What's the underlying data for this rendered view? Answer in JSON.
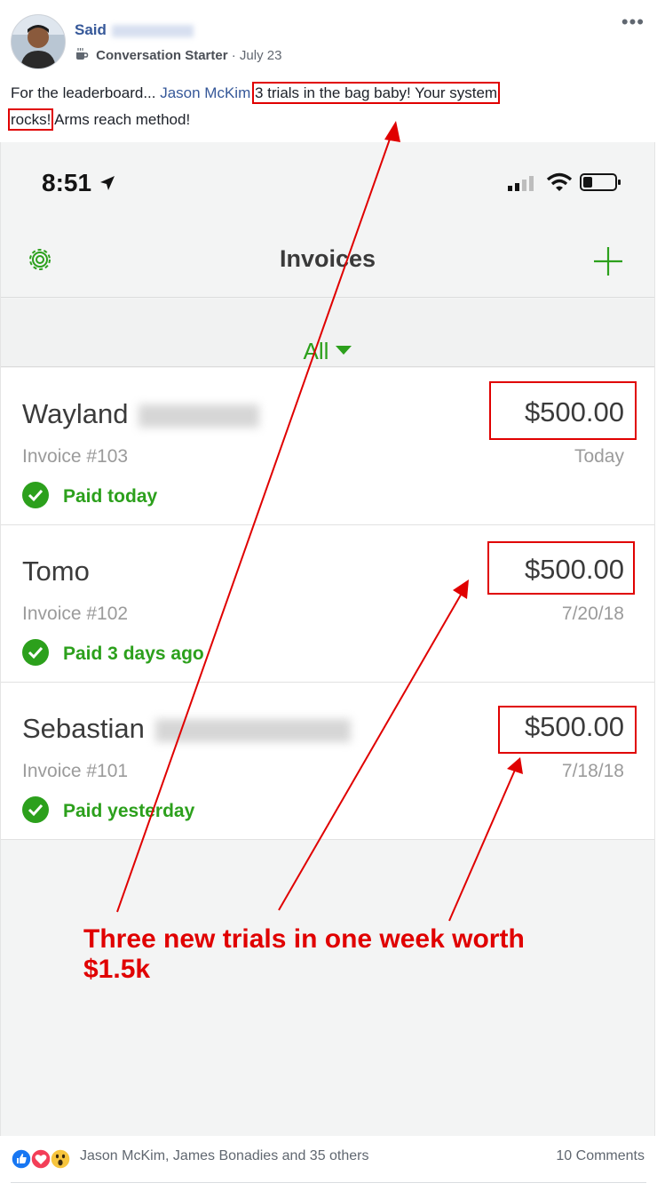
{
  "post": {
    "author": "Said",
    "badge": "Conversation Starter",
    "separator": "·",
    "date": "July 23",
    "more": "•••",
    "text_prefix": "For the leaderboard... ",
    "mention": "Jason McKim",
    "text_highlight_1": "3 trials in the bag baby! Your system",
    "text_highlight_2": "rocks!",
    "text_suffix": " Arms reach method!"
  },
  "phone": {
    "time": "8:51",
    "title": "Invoices",
    "filter": "All",
    "invoices": [
      {
        "name": "Wayland",
        "invoice": "Invoice #103",
        "amount": "$500.00",
        "date": "Today",
        "status": "Paid today"
      },
      {
        "name": "Tomo",
        "invoice": "Invoice #102",
        "amount": "$500.00",
        "date": "7/20/18",
        "status": "Paid 3 days ago"
      },
      {
        "name": "Sebastian",
        "invoice": "Invoice #101",
        "amount": "$500.00",
        "date": "7/18/18",
        "status": "Paid yesterday"
      }
    ]
  },
  "annotation": {
    "line1": "Three new trials in one week worth",
    "line2": "$1.5k"
  },
  "footer": {
    "reactions": "Jason McKim, James Bonadies and 35 others",
    "comments": "10 Comments"
  },
  "colors": {
    "brand_green": "#2ca01c",
    "link_blue": "#365899",
    "annotation_red": "#e00000"
  },
  "icons": [
    "coffee-icon",
    "location-arrow-icon",
    "signal-icon",
    "wifi-icon",
    "battery-icon",
    "gear-icon",
    "plus-icon",
    "check-circle-icon",
    "like-icon",
    "love-icon",
    "wow-icon"
  ]
}
